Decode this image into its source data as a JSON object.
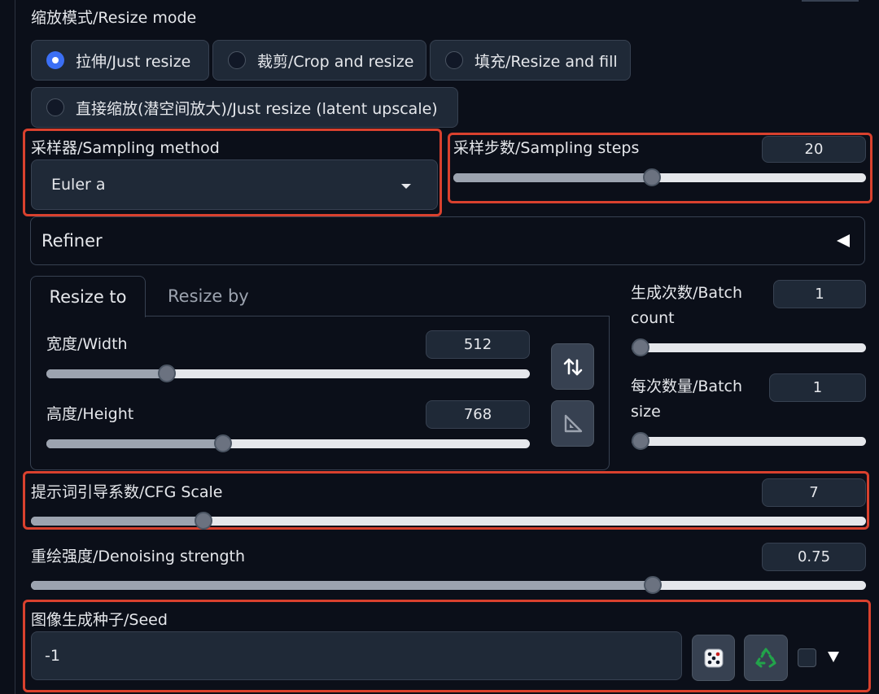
{
  "resize_mode": {
    "label": "缩放模式/Resize mode",
    "options": [
      {
        "label": "拉伸/Just resize",
        "selected": true
      },
      {
        "label": "裁剪/Crop and resize",
        "selected": false
      },
      {
        "label": "填充/Resize and fill",
        "selected": false
      },
      {
        "label": "直接缩放(潜空间放大)/Just resize (latent upscale)",
        "selected": false
      }
    ]
  },
  "sampler": {
    "label": "采样器/Sampling method",
    "value": "Euler a"
  },
  "steps": {
    "label": "采样步数/Sampling steps",
    "value": "20",
    "fraction": 0.48
  },
  "refiner": {
    "label": "Refiner"
  },
  "tabs": {
    "resize_to": "Resize to",
    "resize_by": "Resize by"
  },
  "width": {
    "label": "宽度/Width",
    "value": "512",
    "fraction": 0.24
  },
  "height": {
    "label": "高度/Height",
    "value": "768",
    "fraction": 0.36
  },
  "batch_count": {
    "label_line1": "生成次数/Batch",
    "label_line2": "count",
    "value": "1",
    "fraction": 0.0
  },
  "batch_size": {
    "label_line1": "每次数量/Batch",
    "label_line2": "size",
    "value": "1",
    "fraction": 0.0
  },
  "cfg": {
    "label": "提示词引导系数/CFG Scale",
    "value": "7",
    "fraction": 0.2
  },
  "denoise": {
    "label": "重绘强度/Denoising strength",
    "value": "0.75",
    "fraction": 0.75
  },
  "seed": {
    "label": "图像生成种子/Seed",
    "value": "-1"
  },
  "icons": {
    "swap": "swap-dimensions-icon",
    "aspect": "aspect-ratio-icon",
    "dice": "dice-icon",
    "recycle": "recycle-icon",
    "dropdown": "triangle-down-icon"
  },
  "colors": {
    "highlight": "#d9412e",
    "accent": "#3b6ff5",
    "background": "#0b0f19",
    "panel": "#1f2937"
  }
}
